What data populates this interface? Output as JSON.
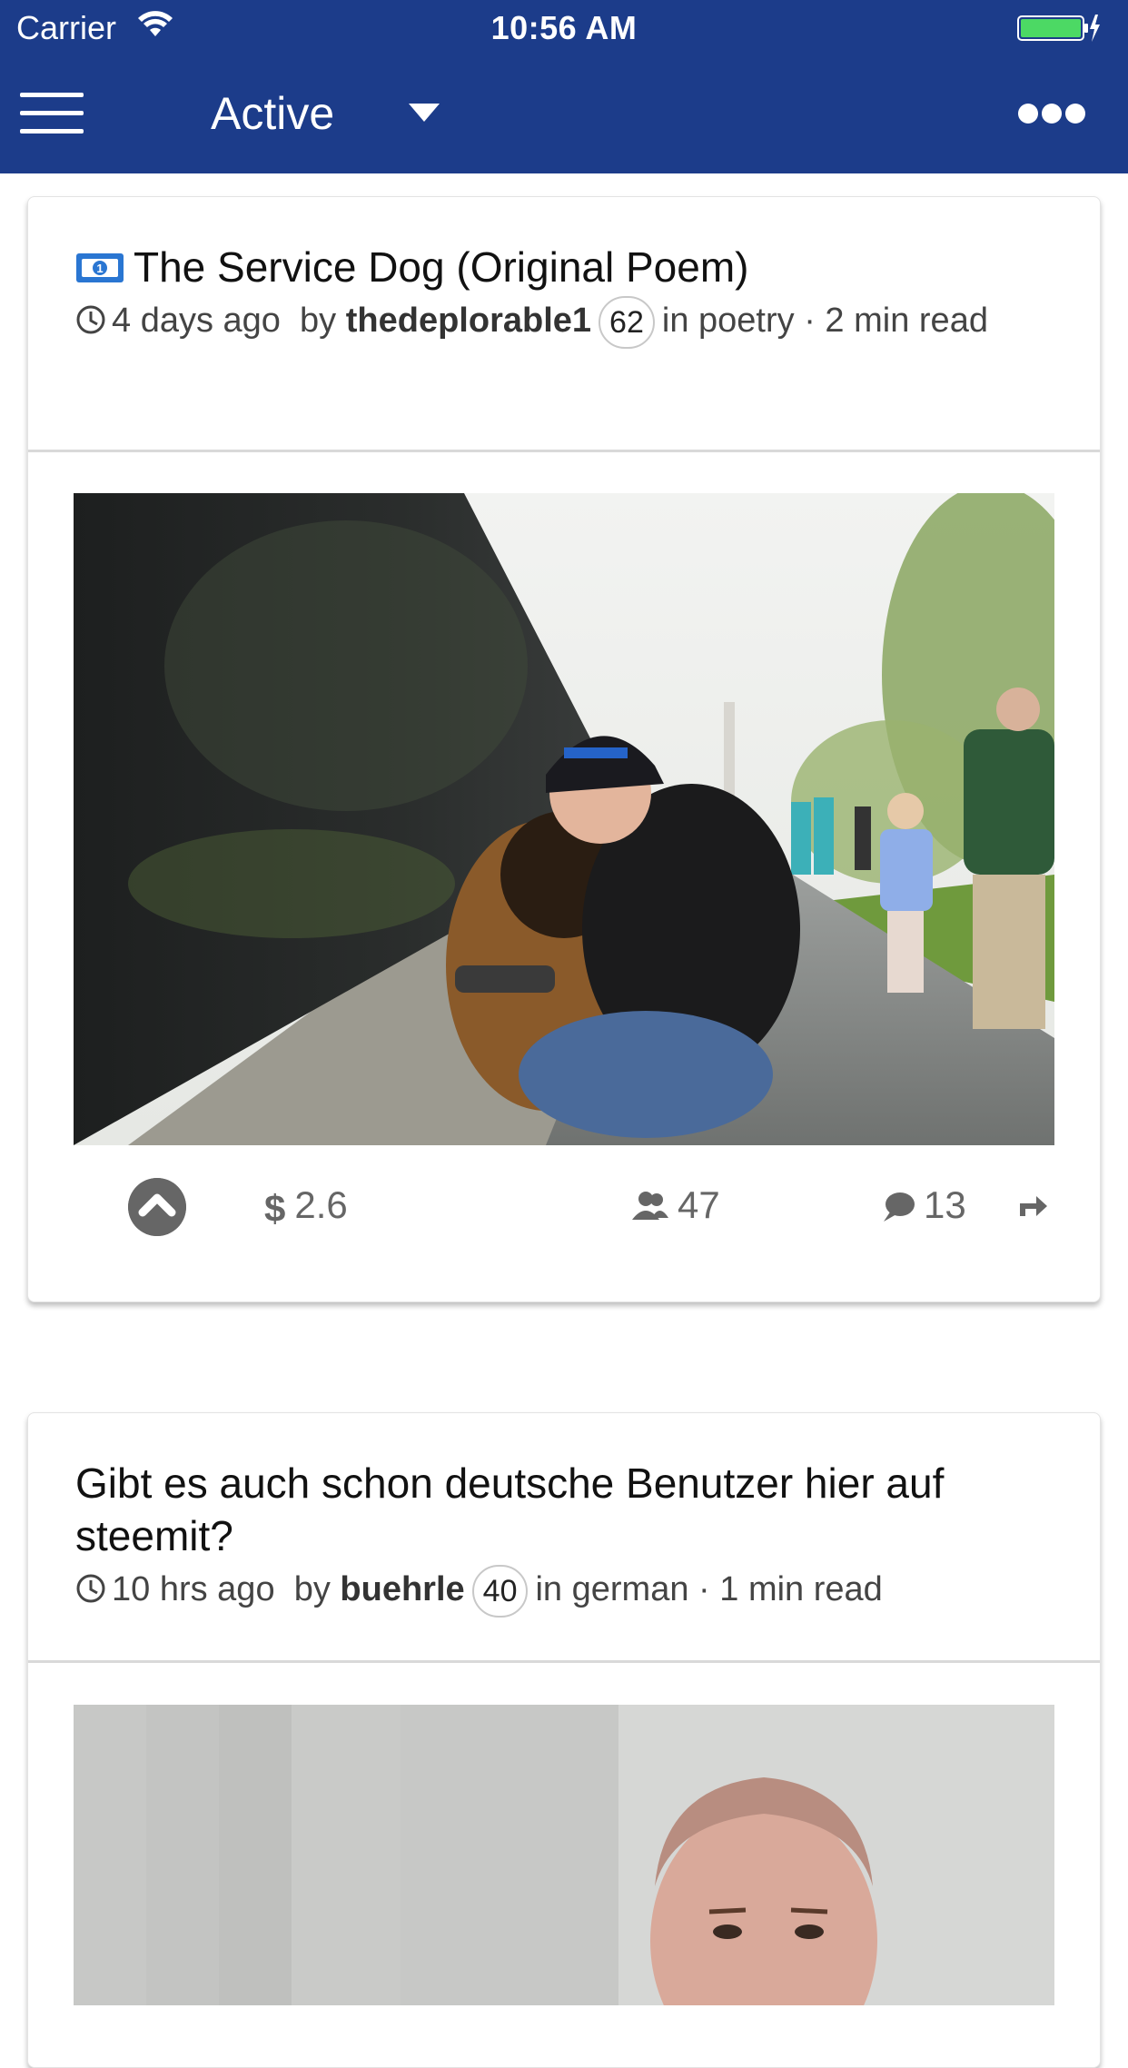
{
  "status_bar": {
    "carrier": "Carrier",
    "time": "10:56 AM"
  },
  "nav": {
    "title": "Active"
  },
  "colors": {
    "header_bg": "#1c3c8a",
    "battery": "#4cd964"
  },
  "posts": [
    {
      "title": "The Service Dog (Original Poem)",
      "time_ago": "4 days ago",
      "by_label": "by",
      "author": "thedeplorable1",
      "reputation": "62",
      "in_label": "in",
      "category": "poetry",
      "separator": "·",
      "read_time": "2 min read",
      "payout_symbol": "$",
      "payout": "2.6",
      "voters": "47",
      "comments": "13"
    },
    {
      "title": "Gibt es auch schon deutsche Benutzer hier auf steemit?",
      "time_ago": "10 hrs ago",
      "by_label": "by",
      "author": "buehrle",
      "reputation": "40",
      "in_label": "in",
      "category": "german",
      "separator": "·",
      "read_time": "1 min read"
    }
  ],
  "icons": [
    "wifi-icon",
    "battery-icon",
    "menu-icon",
    "caret-down-icon",
    "more-icon",
    "promoted-icon",
    "clock-icon",
    "upvote-icon",
    "dollar-icon",
    "voters-icon",
    "comments-icon",
    "share-icon"
  ]
}
